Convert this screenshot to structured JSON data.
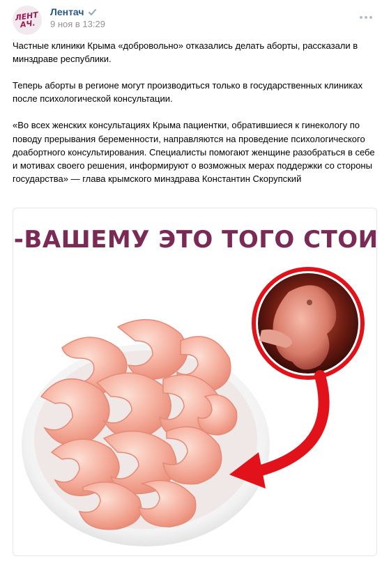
{
  "author": {
    "name": "Лентач",
    "avatar_text": "ЛЕНТАЧ.",
    "verified": true,
    "timestamp": "9 ноя в 13:29"
  },
  "icons": {
    "verified": "verified-check-icon",
    "more": "more-dots-icon"
  },
  "post": {
    "paragraphs": [
      "Частные клиники Крыма «добровольно» отказались делать аборты, рассказали в минздраве республики.",
      "Теперь аборты в регионе могут производиться только в государственных клиниках после психологической консультации.",
      "«Во всех женских консультациях Крыма пациентки, обратившиеся к гинекологу по поводу прерывания беременности, направляются на проведение психологического доабортного консультирования. Специалисты помогают женщине разобраться в себе и мотивах своего решения, информируют о возможных мерах поддержки со стороны государства» — глава крымского минздрава Константин Скорупский"
    ]
  },
  "image": {
    "caption": "ПО-ВАШЕМУ ЭТО ТОГО СТОИТ?"
  },
  "colors": {
    "link": "#2a5885",
    "meta": "#939393",
    "caption": "#7a2a55",
    "arrow": "#e1121a",
    "shrimp": "#f4a994"
  }
}
